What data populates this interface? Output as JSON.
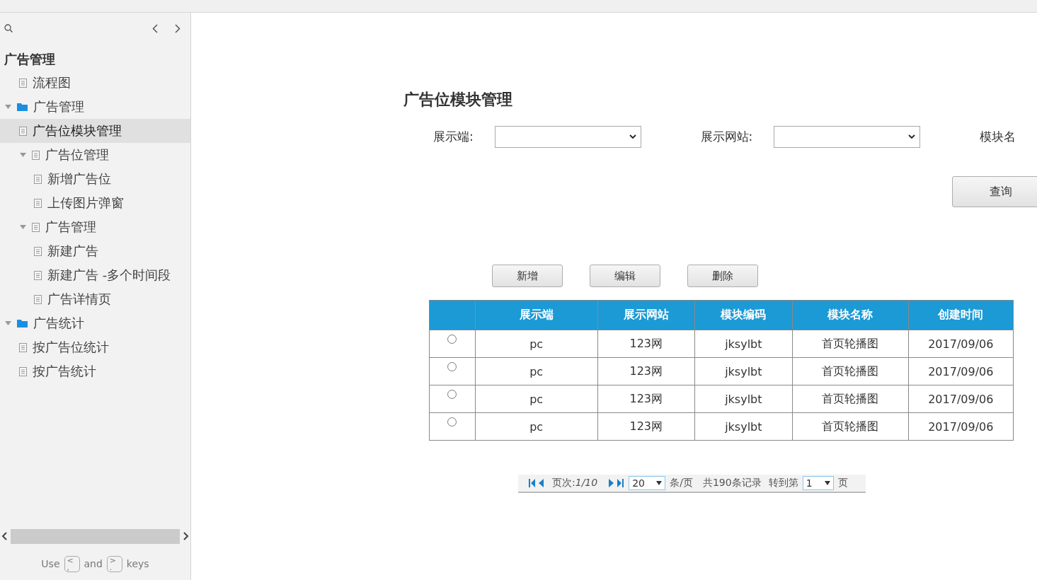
{
  "sidebar": {
    "title": "广告管理",
    "tree": [
      {
        "label": "流程图",
        "kind": "page",
        "selected": false
      },
      {
        "label": "广告管理",
        "kind": "folder",
        "expanded": true,
        "selected": false,
        "children": [
          {
            "label": "广告位模块管理",
            "kind": "page",
            "selected": true
          },
          {
            "label": "广告位管理",
            "kind": "page",
            "expanded": true,
            "selected": false,
            "children": [
              {
                "label": "新增广告位",
                "kind": "page",
                "selected": false
              },
              {
                "label": "上传图片弹窗",
                "kind": "page",
                "selected": false
              }
            ]
          },
          {
            "label": "广告管理",
            "kind": "page",
            "expanded": true,
            "selected": false,
            "children": [
              {
                "label": "新建广告",
                "kind": "page",
                "selected": false
              },
              {
                "label": "新建广告 -多个时间段",
                "kind": "page",
                "selected": false
              },
              {
                "label": "广告详情页",
                "kind": "page",
                "selected": false
              }
            ]
          }
        ]
      },
      {
        "label": "广告统计",
        "kind": "folder",
        "expanded": true,
        "selected": false,
        "children": [
          {
            "label": "按广告位统计",
            "kind": "page",
            "selected": false
          },
          {
            "label": "按广告统计",
            "kind": "page",
            "selected": false
          }
        ]
      }
    ],
    "hint": {
      "before": "Use",
      "key1": {
        "top": "<",
        "bottom": ","
      },
      "middle": "and",
      "key2": {
        "top": ">",
        "bottom": "."
      },
      "after": "keys"
    }
  },
  "page": {
    "title": "广告位模块管理",
    "filters": [
      {
        "label": "展示端:"
      },
      {
        "label": "展示网站:"
      }
    ],
    "cut_label": "模块名",
    "query_button": "查询",
    "actions": [
      "新增",
      "编辑",
      "删除"
    ],
    "table": {
      "columns": [
        "",
        "展示端",
        "展示网站",
        "模块编码",
        "模块名称",
        "创建时间"
      ],
      "rows": [
        {
          "selected": false,
          "cells": [
            "",
            "pc",
            "123网",
            "jksylbt",
            "首页轮播图",
            "2017/09/06"
          ]
        },
        {
          "selected": false,
          "cells": [
            "",
            "pc",
            "123网",
            "jksylbt",
            "首页轮播图",
            "2017/09/06"
          ]
        },
        {
          "selected": false,
          "cells": [
            "",
            "pc",
            "123网",
            "jksylbt",
            "首页轮播图",
            "2017/09/06"
          ]
        },
        {
          "selected": false,
          "cells": [
            "",
            "pc",
            "123网",
            "jksylbt",
            "首页轮播图",
            "2017/09/06"
          ]
        }
      ]
    },
    "pager": {
      "page_label": "页次:",
      "page_value": "1/10",
      "page_size": "20",
      "per_page": "条/页",
      "total": "共190条记录",
      "goto": "转到第",
      "goto_value": "1",
      "page_unit": "页"
    }
  }
}
